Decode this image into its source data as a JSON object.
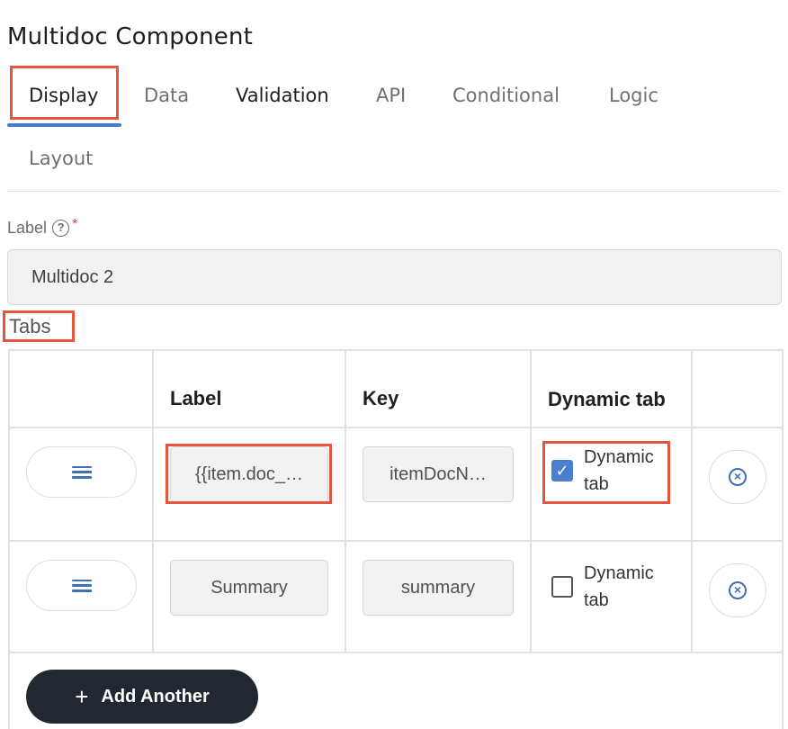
{
  "title": "Multidoc Component",
  "tabs": [
    {
      "label": "Display",
      "active": true
    },
    {
      "label": "Data"
    },
    {
      "label": "Validation"
    },
    {
      "label": "API"
    },
    {
      "label": "Conditional"
    },
    {
      "label": "Logic"
    },
    {
      "label": "Layout"
    }
  ],
  "label_field": {
    "label": "Label",
    "help_icon": "question-circle-icon",
    "required_marker": "*",
    "value": "Multidoc 2"
  },
  "tabs_section": {
    "heading": "Tabs",
    "columns": [
      "",
      "Label",
      "Key",
      "Dynamic tab",
      ""
    ],
    "rows": [
      {
        "label": "{{item.doc_…",
        "key": "itemDocN…",
        "dynamic_label": "Dynamic tab",
        "dynamic_checked": true
      },
      {
        "label": "Summary",
        "key": "summary",
        "dynamic_label": "Dynamic tab",
        "dynamic_checked": false
      }
    ],
    "add_button": "Add Another",
    "add_icon": "plus-icon"
  },
  "colors": {
    "highlight": "#e8553d",
    "accent": "#3f7fd1",
    "checkbox": "#4a7fd0",
    "add_button_bg": "#222831"
  }
}
